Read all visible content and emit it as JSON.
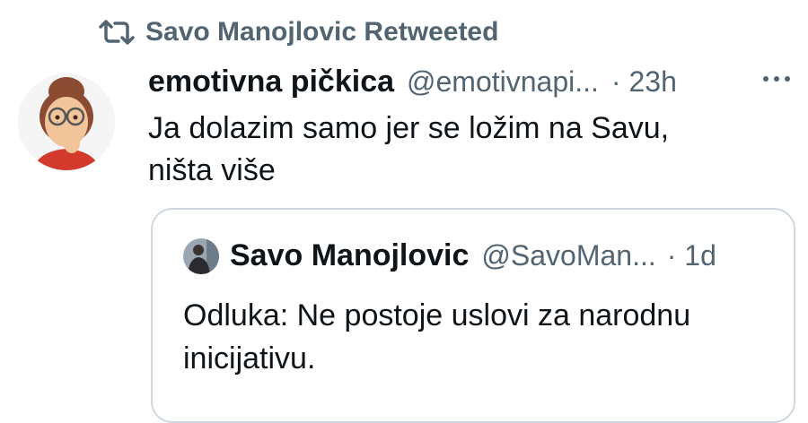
{
  "retweet": {
    "icon": "retweet-icon",
    "text": "Savo Manojlovic Retweeted"
  },
  "tweet": {
    "avatar_icon": "memoji-avatar",
    "author_name": "emotivna pičkica",
    "author_handle": "@emotivnapi...",
    "time": "· 23h",
    "more_icon": "more-icon",
    "text_lines": [
      "Ja dolazim samo jer se ložim na Savu,",
      "ništa više"
    ]
  },
  "quoted_tweet": {
    "avatar_icon": "profile-photo-avatar",
    "author_name": "Savo Manojlovic",
    "author_handle": "@SavoMan...",
    "time": "· 1d",
    "text_lines": [
      "Odluka: Ne postoje uslovi za narodnu",
      "inicijativu."
    ]
  },
  "colors": {
    "text": "#0f1419",
    "secondary": "#536471",
    "border": "#cfd9de"
  }
}
